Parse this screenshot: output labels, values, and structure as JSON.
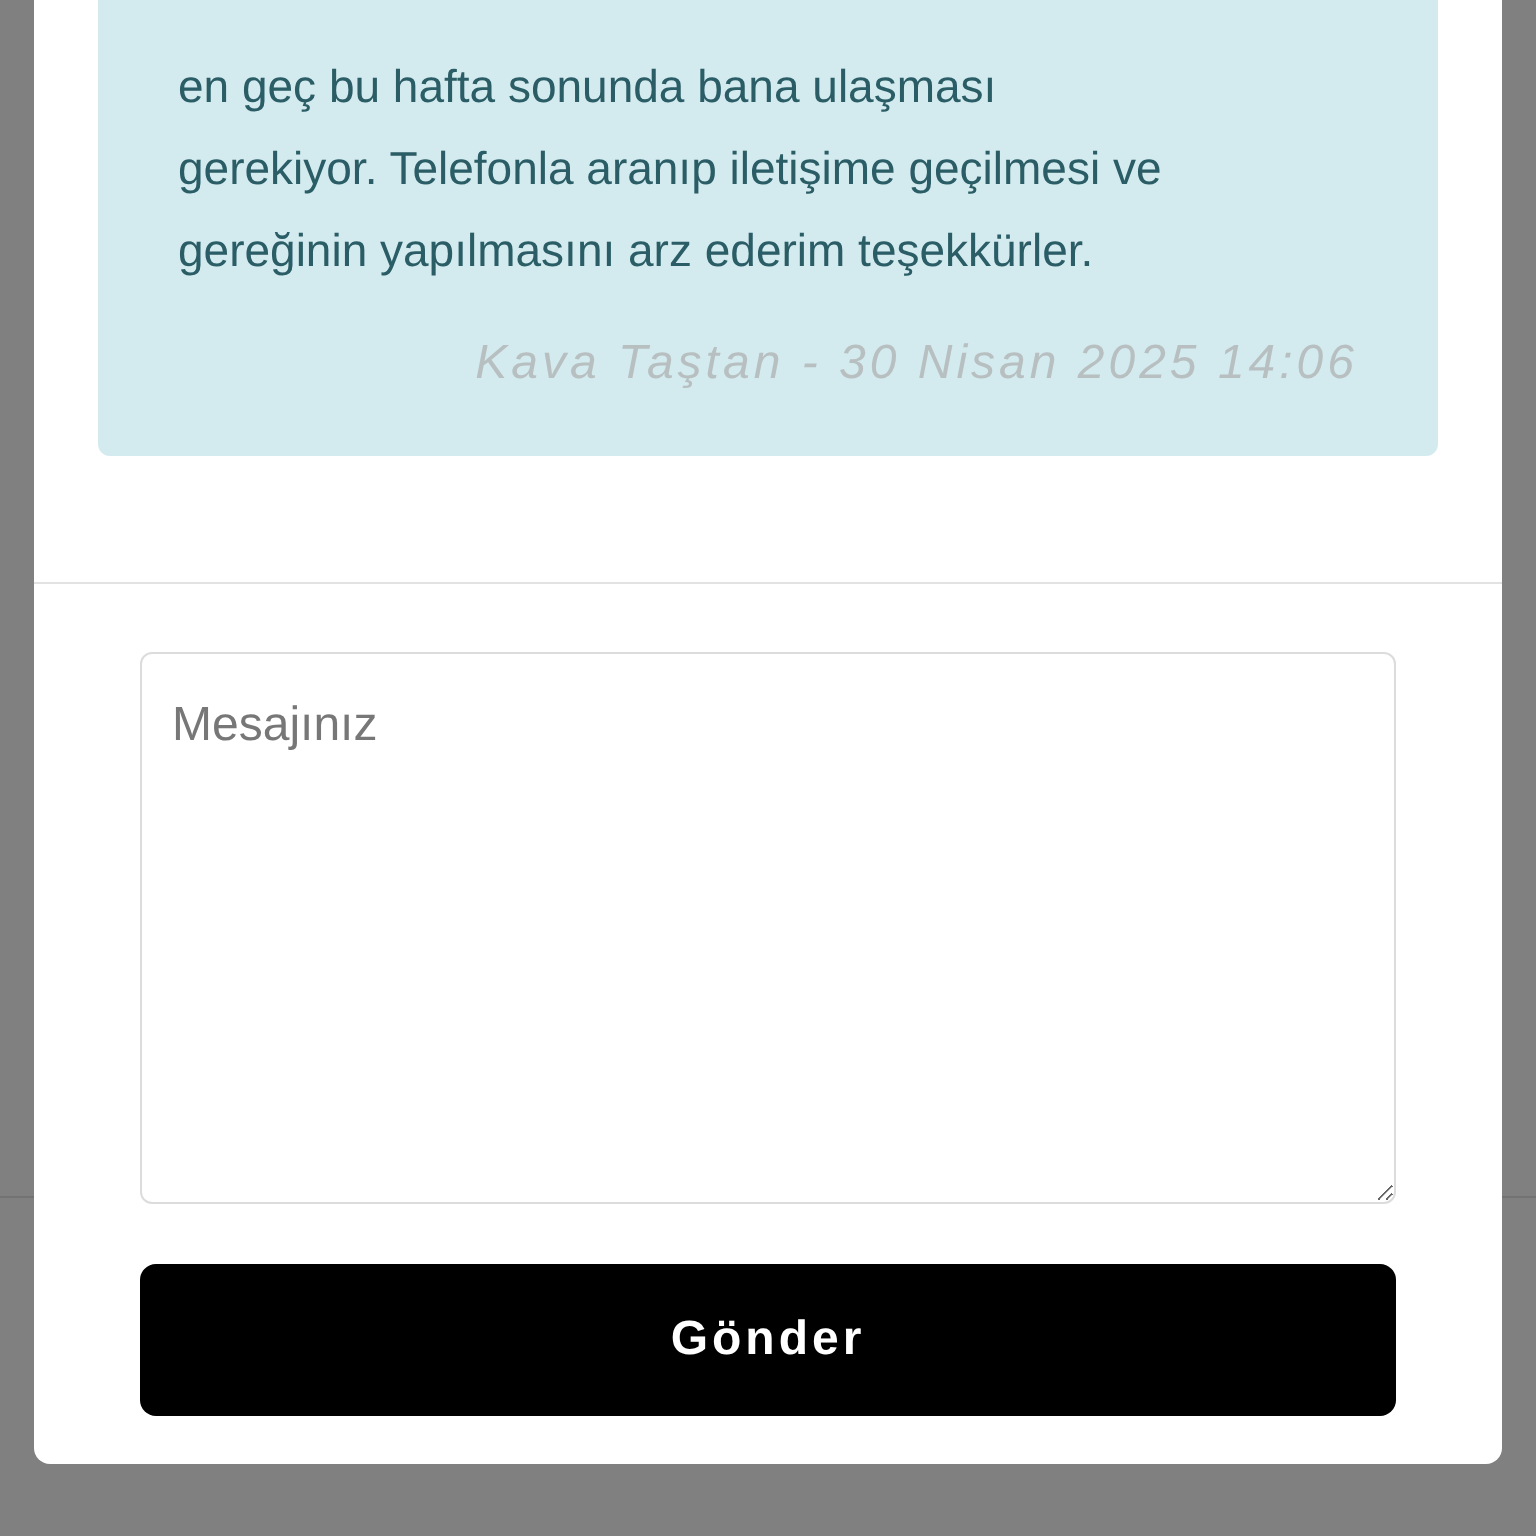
{
  "message": {
    "lines": [
      "en geç bu hafta sonunda bana ulaşması",
      "gerekiyor. Telefonla aranıp iletişime geçilmesi ve",
      "gereğinin yapılmasını arz ederim teşekkürler."
    ],
    "signature": "Kava Taştan - 30 Nisan 2025 14:06"
  },
  "reply": {
    "placeholder": "Mesajınız"
  },
  "send_button": "Gönder"
}
